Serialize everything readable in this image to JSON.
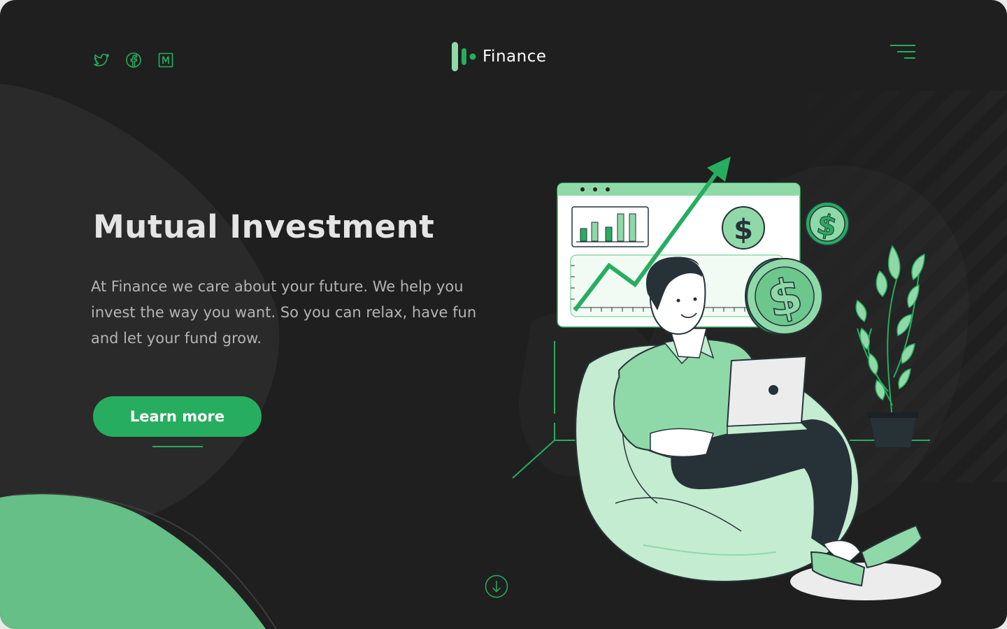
{
  "header": {
    "brand_name": "Finance",
    "social_icons": [
      "twitter-icon",
      "facebook-icon",
      "medium-icon"
    ],
    "menu_icon": "hamburger-menu-icon"
  },
  "hero": {
    "title": "Mutual Investment",
    "body": "At Finance we care about your future. We help you invest the way you want. So you can relax, have fun and let your fund grow.",
    "cta_label": "Learn more"
  },
  "scroll_icon": "arrow-down-circle-icon",
  "colors": {
    "background": "#1f1f1f",
    "accent": "#27ad5f",
    "light_green": "#8fd9a8",
    "pale_green": "#c4ecd0",
    "text_light": "#e4e4e4",
    "text_muted": "#b4b4b4"
  }
}
